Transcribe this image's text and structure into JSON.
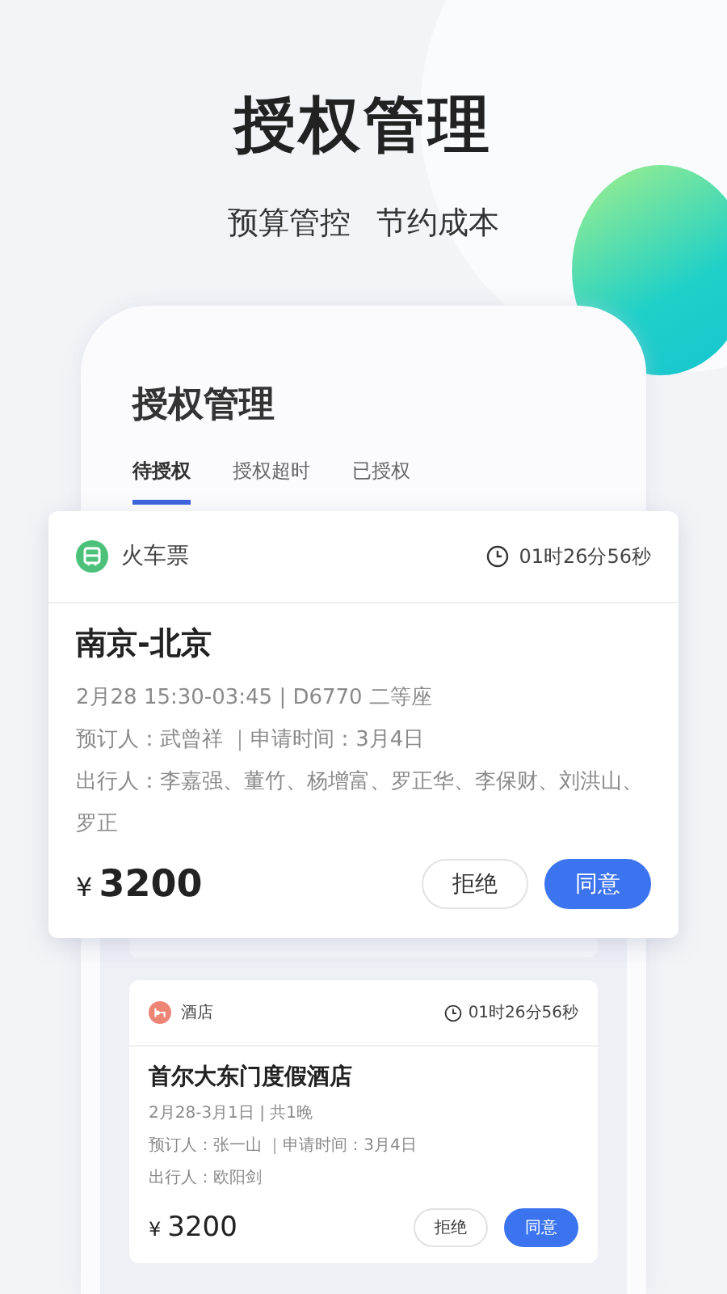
{
  "header": {
    "title": "授权管理",
    "subtitle": [
      "预算管控",
      "节约成本"
    ]
  },
  "screen": {
    "title": "授权管理",
    "tabs": [
      {
        "label": "待授权",
        "selected": true
      },
      {
        "label": "授权超时",
        "selected": false
      },
      {
        "label": "已授权",
        "selected": false
      }
    ]
  },
  "orders": [
    {
      "kind": "train",
      "category": "火车票",
      "countdown": "01时26分56秒",
      "title": "南京-北京",
      "details": [
        "2月28 15:30-03:45 | D6770 二等座",
        "预订人：武曾祥 ｜申请时间：3月4日",
        "出行人：李嘉强、董竹、杨增富、罗正华、李保财、刘洪山、罗正"
      ],
      "currency": "¥",
      "amount": "3200",
      "actions": [
        {
          "label": "拒绝",
          "primary": false
        },
        {
          "label": "同意",
          "primary": true
        }
      ]
    },
    {
      "kind": "hotel",
      "category": "酒店",
      "countdown": "01时26分56秒",
      "title": "首尔大东门度假酒店",
      "details": [
        "2月28-3月1日 | 共1晚",
        "预订人：张一山 ｜申请时间：3月4日",
        "出行人：欧阳剑"
      ],
      "currency": "¥",
      "amount": "3200",
      "actions": [
        {
          "label": "拒绝",
          "primary": false
        },
        {
          "label": "同意",
          "primary": true
        }
      ]
    }
  ]
}
